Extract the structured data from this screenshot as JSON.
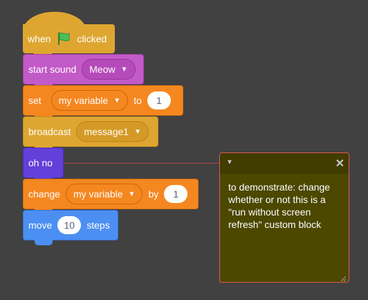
{
  "script": {
    "hat": {
      "when": "when",
      "clicked": "clicked",
      "flag_icon": "green-flag"
    },
    "start_sound": {
      "label": "start sound",
      "value": "Meow"
    },
    "set_var": {
      "label": "set",
      "variable": "my variable",
      "to": "to",
      "value": "1"
    },
    "broadcast": {
      "label": "broadcast",
      "value": "message1"
    },
    "custom": {
      "label": "oh no"
    },
    "change_var": {
      "label": "change",
      "variable": "my variable",
      "by": "by",
      "value": "1"
    },
    "move": {
      "label": "move",
      "value": "10",
      "suffix": "steps"
    }
  },
  "comment": {
    "text": "to demonstrate: change whether or not this is a \"run without screen refresh\" custom block"
  },
  "colors": {
    "events": "#dea631",
    "sound": "#c25ac7",
    "variables": "#f58720",
    "custom": "#6340d9",
    "motion": "#4c8ff2",
    "comment": "#4c4800"
  }
}
